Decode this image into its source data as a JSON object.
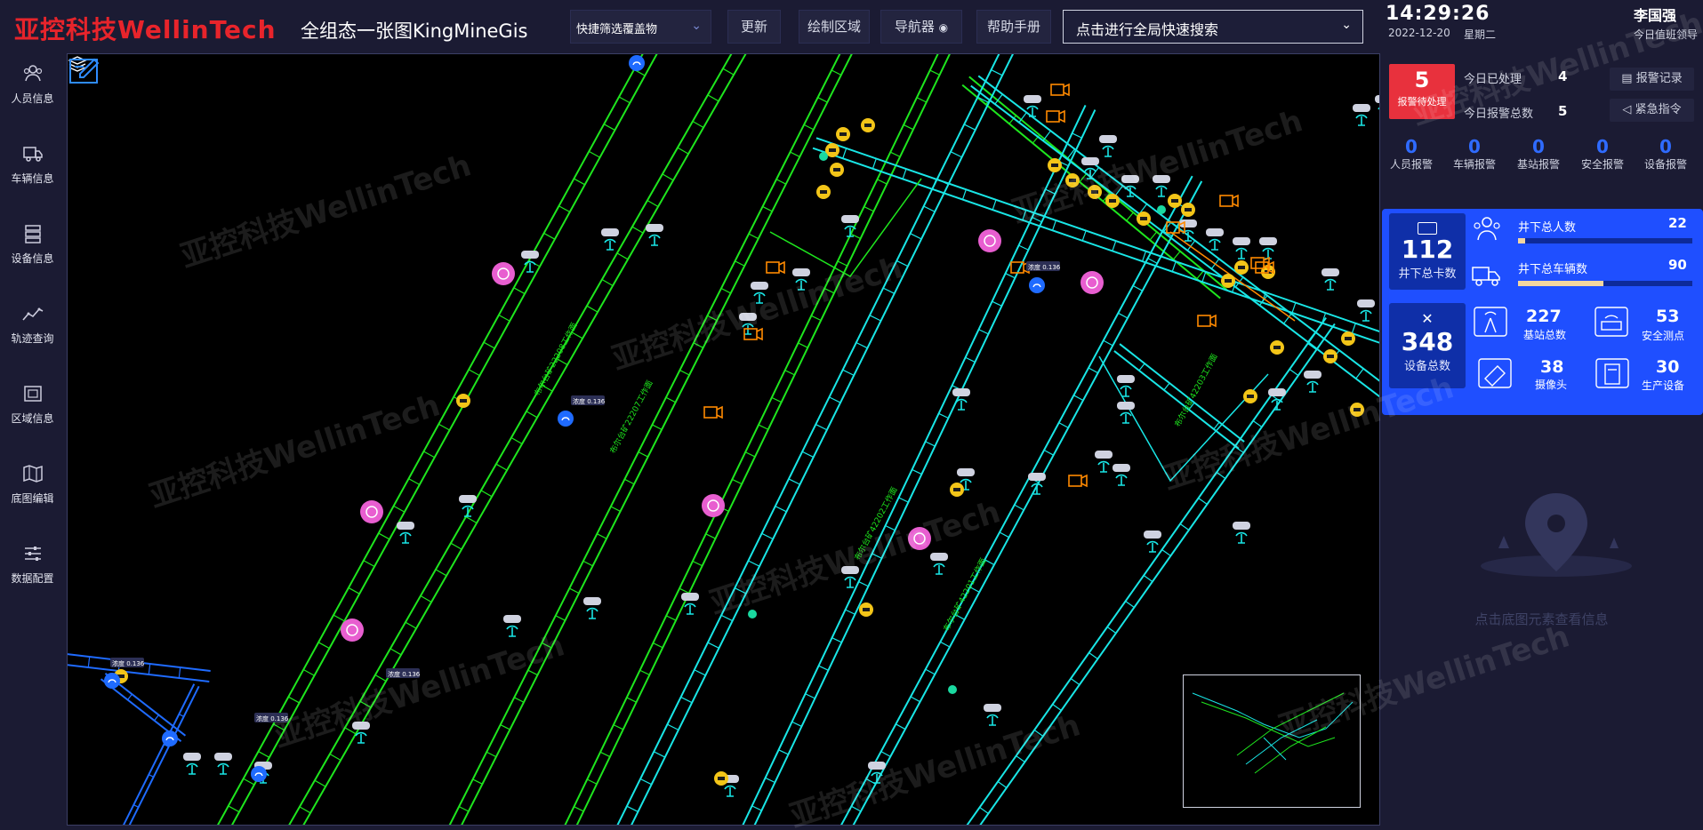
{
  "header": {
    "logo_text": "亚控科技WellinTech",
    "app_title": "全组态一张图KingMineGis",
    "filter_select": "快捷筛选覆盖物",
    "buttons": [
      {
        "label": "更新"
      },
      {
        "label": "绘制区域"
      },
      {
        "label": "导航器"
      },
      {
        "label": "帮助手册"
      }
    ],
    "search_placeholder": "点击进行全局快速搜索"
  },
  "sidebar": {
    "items": [
      {
        "label": "人员信息",
        "icon": "people-icon"
      },
      {
        "label": "车辆信息",
        "icon": "truck-icon"
      },
      {
        "label": "设备信息",
        "icon": "server-icon"
      },
      {
        "label": "轨迹查询",
        "icon": "trajectory-icon"
      },
      {
        "label": "区域信息",
        "icon": "area-icon"
      },
      {
        "label": "底图编辑",
        "icon": "map-icon"
      },
      {
        "label": "数据配置",
        "icon": "sliders-icon"
      }
    ]
  },
  "status": {
    "time": "14:29:26",
    "date": "2022-12-20",
    "weekday": "星期二",
    "user": "李国强",
    "role": "今日值班领导"
  },
  "alarms": {
    "pending_count": "5",
    "pending_label": "报警待处理",
    "handled_label": "今日已处理",
    "handled_value": "4",
    "total_label": "今日报警总数",
    "total_value": "5",
    "record_button": "报警记录",
    "emergency_button": "紧急指令",
    "categories": [
      {
        "count": "0",
        "label": "人员报警"
      },
      {
        "count": "0",
        "label": "车辆报警"
      },
      {
        "count": "0",
        "label": "基站报警"
      },
      {
        "count": "0",
        "label": "安全报警"
      },
      {
        "count": "0",
        "label": "设备报警"
      }
    ]
  },
  "summary": {
    "cards_total": "112",
    "cards_label": "井下总卡数",
    "people_label": "井下总人数",
    "people_value": "22",
    "people_fraction": 0.04,
    "vehicles_label": "井下总车辆数",
    "vehicles_value": "90",
    "vehicles_fraction": 0.49,
    "devices_total": "348",
    "devices_label": "设备总数",
    "base_station_value": "227",
    "base_station_label": "基站总数",
    "safety_value": "53",
    "safety_label": "安全测点",
    "camera_value": "38",
    "camera_label": "摄像头",
    "production_value": "30",
    "production_label": "生产设备"
  },
  "info_hint": "点击底图元素查看信息",
  "watermark": "亚控科技WellinTech",
  "map": {
    "map_labels": [
      "布尔台矿22208工作面",
      "布尔台矿22207工作面",
      "布尔台矿42202工作面",
      "布尔台矿42201工作面",
      "布尔台矿42203工作面"
    ],
    "sensor_label": "浓度 0.136",
    "colors": {
      "green": "#1ee61e",
      "cyan": "#19e6e6",
      "blue": "#1f6bff",
      "orange": "#ff8a00"
    }
  }
}
